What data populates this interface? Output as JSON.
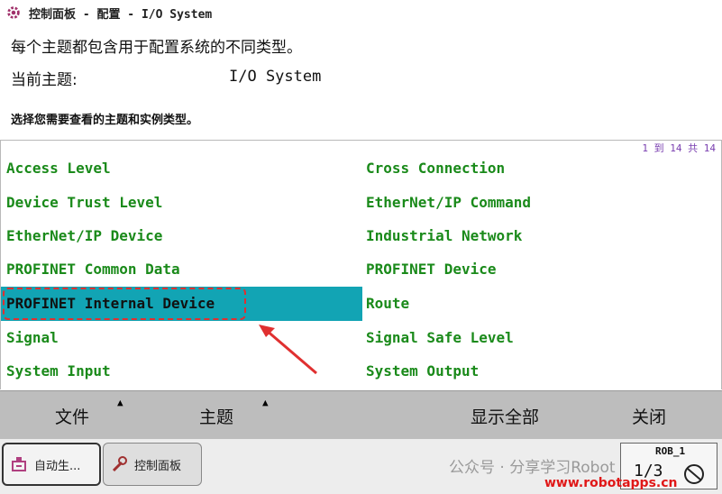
{
  "window": {
    "title": "控制面板 - 配置 - I/O System",
    "icon": "gear-icon"
  },
  "header": {
    "description": "每个主题都包含用于配置系统的不同类型。",
    "current_topic_label": "当前主题:",
    "current_topic_value": "I/O System",
    "instruction": "选择您需要查看的主题和实例类型。"
  },
  "list": {
    "page_info": "1 到 14 共 14",
    "selected": "PROFINET Internal Device",
    "left": [
      "Access Level",
      "Device Trust Level",
      "EtherNet/IP Device",
      "PROFINET Common Data",
      "PROFINET Internal Device",
      "Signal",
      "System Input"
    ],
    "right": [
      "Cross Connection",
      "EtherNet/IP Command",
      "Industrial Network",
      "PROFINET Device",
      "Route",
      "Signal Safe Level",
      "System Output"
    ]
  },
  "commands": {
    "file": "文件",
    "topic": "主题",
    "show_all": "显示全部",
    "close": "关闭"
  },
  "taskbar": {
    "tasks": [
      {
        "label": "自动生...",
        "icon": "robot-icon"
      },
      {
        "label": "控制面板",
        "icon": "wrench-icon"
      }
    ],
    "robot_status": {
      "name": "ROB_1",
      "fraction": "1/3"
    }
  },
  "overlay": {
    "watermark": "公众号 · 分享学习Robot",
    "site": "www.robotapps.cn"
  },
  "colors": {
    "item_text": "#1a8a1a",
    "selection": "#12a4b4",
    "annotation": "#e03030",
    "page_info": "#7a3fb0"
  }
}
